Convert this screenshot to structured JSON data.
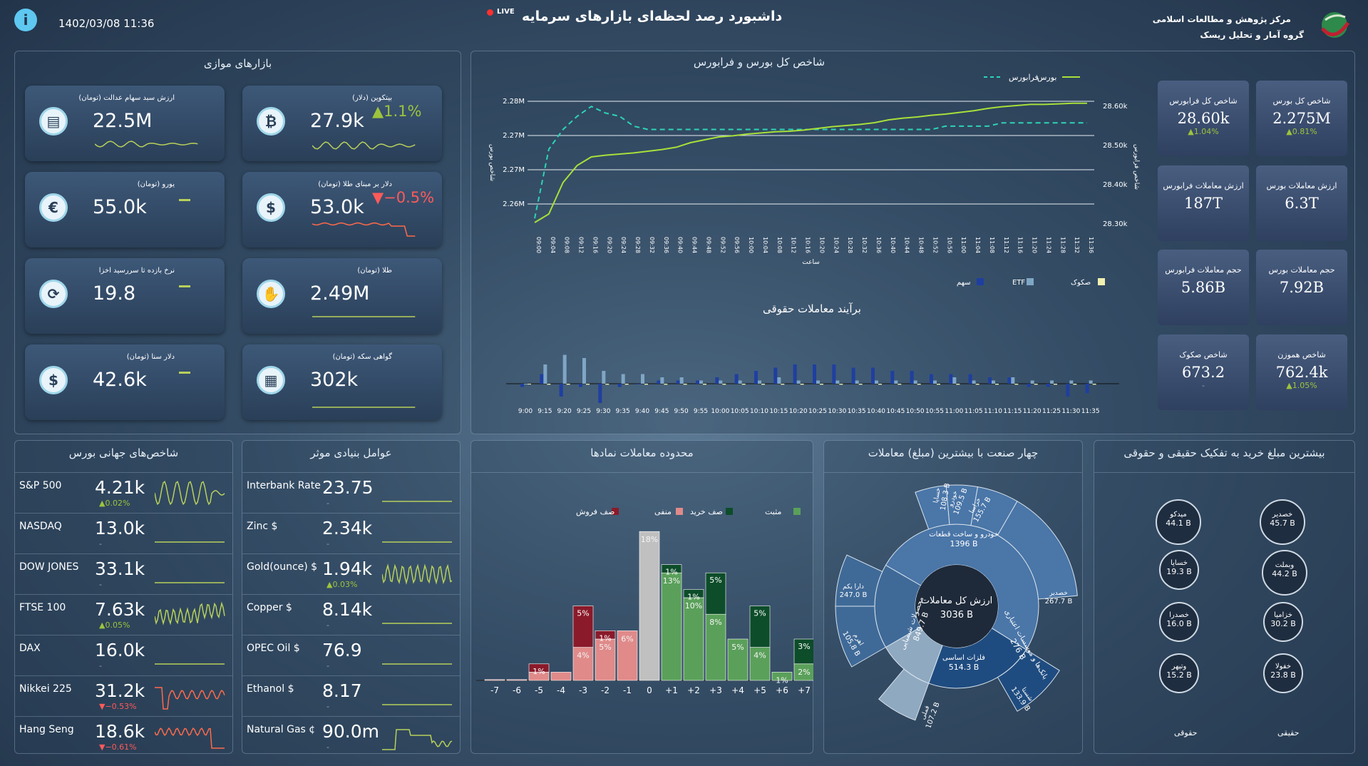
{
  "header": {
    "date": "1402/03/08 11:36",
    "title": "داشبورد رصد لحظه‌ای بازارهای سرمایه",
    "live": "LIVE",
    "org1": "مرکز پژوهش و مطالعات اسلامی",
    "org2": "گروه آمار و تحلیل ریسک"
  },
  "parallel": {
    "title": "بازارهای موازی",
    "cards": [
      {
        "t": "ارزش سبد سهام عدالت (تومان)",
        "v": "22.5M",
        "icon": "coins-icon"
      },
      {
        "t": "بیتکوین (دلار)",
        "v": "27.9k",
        "chg": "▲1.1%",
        "icon": "bitcoin-icon"
      },
      {
        "t": "یورو (تومان)",
        "v": "55.0k",
        "icon": "euro-icon"
      },
      {
        "t": "دلار بر مبنای طلا (تومان)",
        "v": "53.0k",
        "chg": "▼−0.5%",
        "icon": "dollar-icon"
      },
      {
        "t": "نرخ بازده تا سررسید اخزا",
        "v": "19.8",
        "icon": "refresh-money-icon"
      },
      {
        "t": "طلا (تومان)",
        "v": "2.49M",
        "icon": "gold-hand-icon"
      },
      {
        "t": "دلار سنا (تومان)",
        "v": "42.6k",
        "icon": "dollar-icon"
      },
      {
        "t": "گواهی سکه (تومان)",
        "v": "302k",
        "icon": "coin-stack-icon"
      }
    ]
  },
  "index_chart": {
    "title": "شاخص کل بورس و فرابورس",
    "legend_bourse": "بورس",
    "legend_farabourse": "فرابورس",
    "xlabel": "ساعت",
    "ylabel_left": "شاخص بورس",
    "ylabel_right": "شاخص فرابورس",
    "left_ticks": [
      "2.28M",
      "2.27M",
      "2.27M",
      "2.26M"
    ],
    "right_ticks": [
      "28.60k",
      "28.50k",
      "28.40k",
      "28.30k"
    ]
  },
  "chart_data": [
    {
      "type": "line",
      "title": "شاخص کل بورس و فرابورس",
      "xlabel": "ساعت",
      "x": [
        "09:00",
        "09:04",
        "09:08",
        "09:12",
        "09:16",
        "09:20",
        "09:24",
        "09:28",
        "09:32",
        "09:36",
        "09:40",
        "09:44",
        "09:48",
        "09:52",
        "09:56",
        "10:00",
        "10:04",
        "10:08",
        "10:12",
        "10:16",
        "10:20",
        "10:24",
        "10:28",
        "10:32",
        "10:36",
        "10:40",
        "10:44",
        "10:48",
        "10:52",
        "10:56",
        "11:00",
        "11:04",
        "11:08",
        "11:12",
        "11:16",
        "11:20",
        "11:24",
        "11:28",
        "11:32",
        "11:36"
      ],
      "series": [
        {
          "name": "بورس",
          "axis": "left",
          "values": [
            2.259,
            2.2605,
            2.266,
            2.269,
            2.2705,
            2.2708,
            2.271,
            2.2712,
            2.2715,
            2.2718,
            2.2722,
            2.273,
            2.2735,
            2.274,
            2.2742,
            2.2745,
            2.2747,
            2.2749,
            2.275,
            2.2752,
            2.2755,
            2.2758,
            2.276,
            2.2762,
            2.2765,
            2.277,
            2.2773,
            2.2775,
            2.2778,
            2.278,
            2.2783,
            2.2786,
            2.279,
            2.2793,
            2.2795,
            2.2797,
            2.2797,
            2.2798,
            2.2799,
            2.2799
          ]
        },
        {
          "name": "فرابورس",
          "axis": "right",
          "values": [
            28.31,
            28.52,
            28.58,
            28.62,
            28.65,
            28.63,
            28.62,
            28.59,
            28.58,
            28.58,
            28.58,
            28.58,
            28.58,
            28.58,
            28.58,
            28.58,
            28.58,
            28.58,
            28.58,
            28.58,
            28.58,
            28.58,
            28.58,
            28.58,
            28.58,
            28.58,
            28.58,
            28.58,
            28.58,
            28.59,
            28.59,
            28.59,
            28.59,
            28.6,
            28.6,
            28.6,
            28.6,
            28.6,
            28.6,
            28.6
          ]
        }
      ]
    },
    {
      "type": "bar",
      "title": "برآیند معاملات حقوقی",
      "categories": [
        "9:00",
        "9:15",
        "9:20",
        "9:25",
        "9:30",
        "9:35",
        "9:40",
        "9:45",
        "9:50",
        "9:55",
        "10:00",
        "10:05",
        "10:10",
        "10:15",
        "10:20",
        "10:25",
        "10:30",
        "10:35",
        "10:40",
        "10:45",
        "10:50",
        "10:55",
        "11:00",
        "11:05",
        "11:10",
        "11:15",
        "11:20",
        "11:25",
        "11:30",
        "11:35"
      ],
      "series": [
        {
          "name": "سهم",
          "values": [
            -1,
            3,
            -4,
            -1,
            -6,
            -1,
            0,
            1,
            1,
            1,
            2,
            3,
            4,
            5,
            6,
            6,
            6,
            5,
            5,
            4,
            4,
            3,
            3,
            3,
            2,
            2,
            -1,
            -1,
            -4,
            -3
          ]
        },
        {
          "name": "ETF",
          "values": [
            0,
            6,
            9,
            8,
            4,
            3,
            3,
            2,
            2,
            1,
            1,
            1,
            1,
            2,
            1,
            1,
            1,
            1,
            1,
            1,
            1,
            1,
            2,
            1,
            1,
            2,
            1,
            1,
            1,
            1
          ]
        },
        {
          "name": "صکوک",
          "values": [
            0,
            -0.3,
            -0.3,
            -0.3,
            -0.3,
            -0.3,
            -0.3,
            -0.3,
            -0.3,
            -0.3,
            -0.3,
            -0.3,
            -0.3,
            -0.3,
            -0.3,
            -0.3,
            -0.3,
            -0.3,
            -0.3,
            -0.3,
            -0.3,
            -0.3,
            -0.3,
            -0.3,
            -0.3,
            -0.3,
            -0.3,
            -0.3,
            -0.3,
            -0.3
          ]
        }
      ]
    },
    {
      "type": "bar",
      "title": "محدوده معاملات نمادها",
      "categories": [
        "-7",
        "-6",
        "-5",
        "-4",
        "-3",
        "-2",
        "-1",
        "0",
        "+1",
        "+2",
        "+3",
        "+4",
        "+5",
        "+6",
        "+7"
      ],
      "series": [
        {
          "name": "صف فروش",
          "values": [
            0,
            0,
            1,
            0,
            5,
            1,
            0,
            0,
            0,
            0,
            0,
            0,
            0,
            0,
            0
          ]
        },
        {
          "name": "منفی",
          "values": [
            0.1,
            0.1,
            1,
            1,
            4,
            5,
            6,
            0,
            0,
            0,
            0,
            0,
            0,
            0,
            0
          ]
        },
        {
          "name": "صف خرید",
          "values": [
            0,
            0,
            0,
            0,
            0,
            0,
            0,
            0,
            1,
            1,
            5,
            0,
            5,
            0,
            3
          ]
        },
        {
          "name": "مثبت",
          "values": [
            0,
            0,
            0,
            0,
            0,
            0,
            0,
            18,
            13,
            10,
            8,
            5,
            4,
            1,
            2
          ]
        }
      ]
    },
    {
      "type": "pie",
      "title": "چهار صنعت با بیشترین (مبلغ) معاملات",
      "center_label": "ارزش کل معاملات",
      "center_value": "3036 B",
      "inner": [
        {
          "label": "خودرو و ساخت قطعات",
          "value": "1396 B"
        },
        {
          "label": "فلزات اساسی",
          "value": "514.3 B"
        },
        {
          "label": "محصولات شیمیایی",
          "value": "849.7 B"
        },
        {
          "label": "بانک‌ها و موسسات اعتباری",
          "value": "276 B"
        }
      ],
      "outer": [
        {
          "label": "خساپا",
          "value": "108.3 B"
        },
        {
          "label": "خودرو",
          "value": "109.5 B"
        },
        {
          "label": "خزامیا",
          "value": "155.7 B"
        },
        {
          "label": "خصدیر",
          "value": "267.7 B"
        },
        {
          "label": "شستا",
          "value": "133.9 B"
        },
        {
          "label": "فملی",
          "value": "107.2 B"
        },
        {
          "label": "دارا یکم",
          "value": "247.0 B"
        },
        {
          "label": "اهرم",
          "value": "105.8 B"
        }
      ]
    }
  ],
  "range_chart": {
    "title": "محدوده معاملات نمادها",
    "legend": [
      "صف فروش",
      "منفی",
      "صف خرید",
      "مثبت"
    ],
    "labels": [
      {
        "cat": "-5",
        "top": "1%"
      },
      {
        "cat": "-3",
        "top": "5%",
        "low": "4%"
      },
      {
        "cat": "-2",
        "top": "1%",
        "low": "5%"
      },
      {
        "cat": "-1",
        "low": "6%"
      },
      {
        "cat": "0",
        "low": "18%"
      },
      {
        "cat": "+1",
        "top": "1%",
        "low": "13%"
      },
      {
        "cat": "+2",
        "top": "1%",
        "low": "10%"
      },
      {
        "cat": "+3",
        "top": "5%",
        "low": "8%"
      },
      {
        "cat": "+4",
        "low": "5%"
      },
      {
        "cat": "+5",
        "top": "5%",
        "low": "4%"
      },
      {
        "cat": "+6",
        "low": "1%"
      },
      {
        "cat": "+7",
        "top": "3%",
        "low": "2%"
      }
    ]
  },
  "legal_trend": {
    "title": "برآیند معاملات حقوقی",
    "legend": [
      "سهم",
      "ETF",
      "صکوک"
    ]
  },
  "kpis": [
    {
      "t": "شاخص کل بورس",
      "v": "2.275M",
      "c": "▲0.81%"
    },
    {
      "t": "شاخص کل فرابورس",
      "v": "28.60k",
      "c": "▲1.04%"
    },
    {
      "t": "ارزش معاملات بورس",
      "v": "6.3T"
    },
    {
      "t": "ارزش معاملات فرابورس",
      "v": "187T"
    },
    {
      "t": "حجم معاملات بورس",
      "v": "7.92B"
    },
    {
      "t": "حجم معاملات فرابورس",
      "v": "5.86B"
    },
    {
      "t": "شاخص هموزن",
      "v": "762.4k",
      "c": "▲1.05%"
    },
    {
      "t": "شاخص صکوک",
      "v": "673.2",
      "d": "-"
    }
  ],
  "global": {
    "title": "شاخص‌های جهانی بورس",
    "rows": [
      {
        "n": "S&P 500",
        "v": "4.21k",
        "c": "▲0.02%",
        "dir": "up"
      },
      {
        "n": "NASDAQ",
        "v": "13.0k",
        "c": "-",
        "dir": "flat"
      },
      {
        "n": "DOW JONES",
        "v": "33.1k",
        "c": "-",
        "dir": "flat"
      },
      {
        "n": "FTSE 100",
        "v": "7.63k",
        "c": "▲0.05%",
        "dir": "up"
      },
      {
        "n": "DAX",
        "v": "16.0k",
        "c": "-",
        "dir": "flat"
      },
      {
        "n": "Nikkei 225",
        "v": "31.2k",
        "c": "▼−0.53%",
        "dir": "down"
      },
      {
        "n": "Hang Seng",
        "v": "18.6k",
        "c": "▼−0.61%",
        "dir": "down"
      }
    ]
  },
  "fundamental": {
    "title": "عوامل بنیادی موثر",
    "rows": [
      {
        "n": "Interbank Rate",
        "v": "23.75",
        "c": "-"
      },
      {
        "n": "Zinc $",
        "v": "2.34k",
        "c": "-"
      },
      {
        "n": "Gold(ounce) $",
        "v": "1.94k",
        "c": "▲0.03%"
      },
      {
        "n": "Copper $",
        "v": "8.14k",
        "c": "-"
      },
      {
        "n": "OPEC Oil $",
        "v": "76.9",
        "c": "-"
      },
      {
        "n": "Ethanol $",
        "v": "8.17",
        "c": "-"
      },
      {
        "n": "Natural Gas ¢",
        "v": "90.0m",
        "c": "-"
      }
    ]
  },
  "industry": {
    "title": "چهار صنعت با بیشترین (مبلغ) معاملات"
  },
  "buyers": {
    "title": "بیشترین مبلغ خرید به تفکیک حقیقی و حقوقی",
    "left_label": "حقوقی",
    "right_label": "حقیقی",
    "left": [
      {
        "n": "میدکو",
        "v": "44.1 B"
      },
      {
        "n": "خساپا",
        "v": "19.3 B"
      },
      {
        "n": "خصدرا",
        "v": "16.0 B"
      },
      {
        "n": "وتپهر",
        "v": "15.2 B"
      }
    ],
    "right": [
      {
        "n": "خصدیر",
        "v": "45.7 B"
      },
      {
        "n": "وبملت",
        "v": "44.2 B"
      },
      {
        "n": "خزامیا",
        "v": "30.2 B"
      },
      {
        "n": "خفولا",
        "v": "23.8 B"
      }
    ]
  },
  "colors": {
    "bourse": "#a8e03a",
    "farabourse": "#2dd4b4",
    "stock": "#1f3fa0",
    "etf": "#7fa6c4",
    "sukuk": "#f1f0b0",
    "sell_queue": "#8a1a2a",
    "negative": "#e08a8a",
    "buy_queue": "#0d4d2a",
    "positive": "#5aa05a"
  }
}
